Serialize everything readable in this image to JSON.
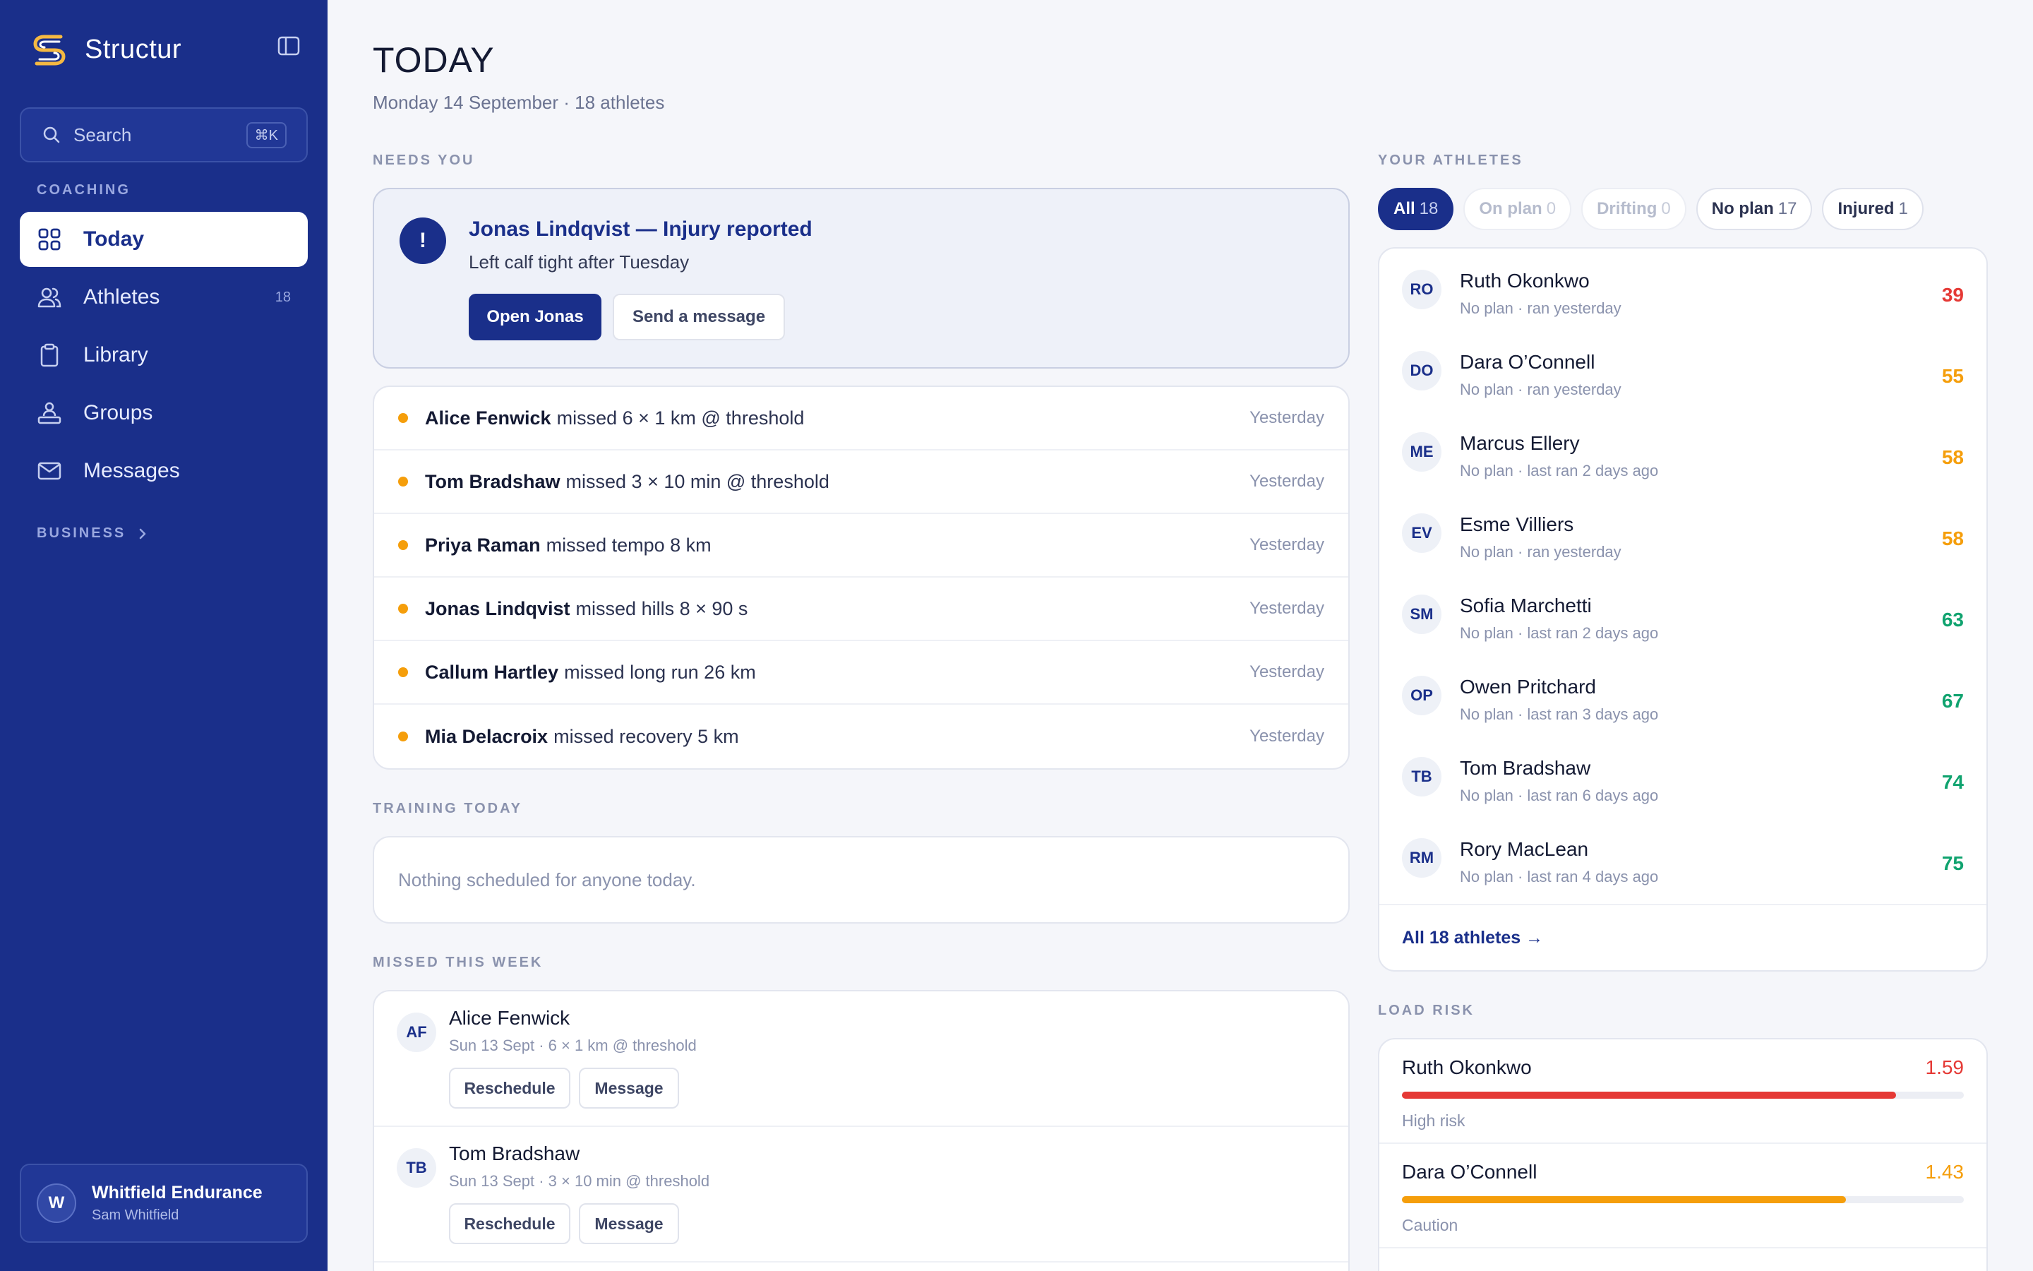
{
  "app": {
    "name": "Structur",
    "search": {
      "placeholder": "Search",
      "shortcut": "⌘K"
    }
  },
  "sidebar": {
    "coaching_label": "COACHING",
    "items": [
      {
        "label": "Today",
        "icon": "grid-icon",
        "active": true,
        "count": ""
      },
      {
        "label": "Athletes",
        "icon": "users-icon",
        "active": false,
        "count": "18"
      },
      {
        "label": "Library",
        "icon": "clipboard-icon",
        "active": false,
        "count": ""
      },
      {
        "label": "Groups",
        "icon": "group-icon",
        "active": false,
        "count": ""
      },
      {
        "label": "Messages",
        "icon": "mail-icon",
        "active": false,
        "count": ""
      }
    ],
    "business_label": "BUSINESS",
    "account": {
      "initial": "W",
      "org": "Whitfield Endurance",
      "user": "Sam Whitfield"
    }
  },
  "page": {
    "title": "TODAY",
    "subtitle": "Monday 14 September · 18 athletes"
  },
  "needs_you": {
    "label": "NEEDS YOU",
    "alert": {
      "title": "Jonas Lindqvist — Injury reported",
      "description": "Left calf tight after Tuesday",
      "primary": "Open Jonas",
      "secondary": "Send a message"
    },
    "missed": [
      {
        "name": "Alice Fenwick",
        "text": "missed 6 × 1 km @ threshold",
        "when": "Yesterday"
      },
      {
        "name": "Tom Bradshaw",
        "text": "missed 3 × 10 min @ threshold",
        "when": "Yesterday"
      },
      {
        "name": "Priya Raman",
        "text": "missed tempo 8 km",
        "when": "Yesterday"
      },
      {
        "name": "Jonas Lindqvist",
        "text": "missed hills 8 × 90 s",
        "when": "Yesterday"
      },
      {
        "name": "Callum Hartley",
        "text": "missed long run 26 km",
        "when": "Yesterday"
      },
      {
        "name": "Mia Delacroix",
        "text": "missed recovery 5 km",
        "when": "Yesterday"
      }
    ]
  },
  "training_today": {
    "label": "TRAINING TODAY",
    "empty": "Nothing scheduled for anyone today."
  },
  "missed_week": {
    "label": "MISSED THIS WEEK",
    "reschedule": "Reschedule",
    "message": "Message",
    "items": [
      {
        "initials": "AF",
        "name": "Alice Fenwick",
        "meta": "Sun 13 Sept · 6 × 1 km @ threshold"
      },
      {
        "initials": "TB",
        "name": "Tom Bradshaw",
        "meta": "Sun 13 Sept · 3 × 10 min @ threshold"
      }
    ]
  },
  "your_athletes": {
    "label": "YOUR ATHLETES",
    "filters": [
      {
        "label": "All",
        "count": "18",
        "state": "active"
      },
      {
        "label": "On plan",
        "count": "0",
        "state": "dim"
      },
      {
        "label": "Drifting",
        "count": "0",
        "state": "dim"
      },
      {
        "label": "No plan",
        "count": "17",
        "state": "normal"
      },
      {
        "label": "Injured",
        "count": "1",
        "state": "normal"
      }
    ],
    "athletes": [
      {
        "initials": "RO",
        "name": "Ruth Okonkwo",
        "meta": "No plan · ran yesterday",
        "score": "39",
        "color": "#e53935"
      },
      {
        "initials": "DO",
        "name": "Dara O’Connell",
        "meta": "No plan · ran yesterday",
        "score": "55",
        "color": "#f59e0b"
      },
      {
        "initials": "ME",
        "name": "Marcus Ellery",
        "meta": "No plan · last ran 2 days ago",
        "score": "58",
        "color": "#f59e0b"
      },
      {
        "initials": "EV",
        "name": "Esme Villiers",
        "meta": "No plan · ran yesterday",
        "score": "58",
        "color": "#f59e0b"
      },
      {
        "initials": "SM",
        "name": "Sofia Marchetti",
        "meta": "No plan · last ran 2 days ago",
        "score": "63",
        "color": "#10a36f"
      },
      {
        "initials": "OP",
        "name": "Owen Pritchard",
        "meta": "No plan · last ran 3 days ago",
        "score": "67",
        "color": "#10a36f"
      },
      {
        "initials": "TB",
        "name": "Tom Bradshaw",
        "meta": "No plan · last ran 6 days ago",
        "score": "74",
        "color": "#10a36f"
      },
      {
        "initials": "RM",
        "name": "Rory MacLean",
        "meta": "No plan · last ran 4 days ago",
        "score": "75",
        "color": "#10a36f"
      }
    ],
    "all_link": "All 18 athletes →"
  },
  "load_risk": {
    "label": "LOAD RISK",
    "items": [
      {
        "name": "Ruth Okonkwo",
        "value": "1.59",
        "status": "High risk",
        "fill": 0.88,
        "color": "#e53935"
      },
      {
        "name": "Dara O’Connell",
        "value": "1.43",
        "status": "Caution",
        "fill": 0.79,
        "color": "#f59e0b"
      }
    ]
  }
}
